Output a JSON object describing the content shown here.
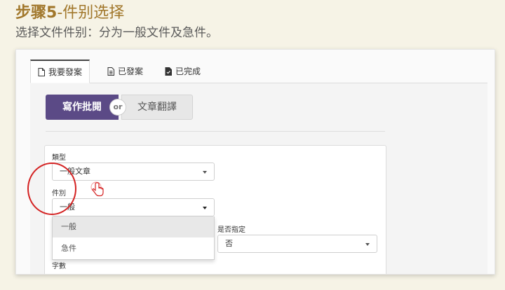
{
  "step": {
    "title_bold": "步骤5",
    "title_rest": "-件别选择",
    "subtitle": "选择文件件别：分为一般文件及急件。"
  },
  "tabs": [
    {
      "label": "我要發案",
      "icon": "document-icon"
    },
    {
      "label": "已發案",
      "icon": "file-lines-icon"
    },
    {
      "label": "已完成",
      "icon": "file-check-icon"
    }
  ],
  "service_toggle": {
    "option_a": "寫作批閱",
    "separator": "or",
    "option_b": "文章翻譯"
  },
  "form": {
    "type_label": "類型",
    "type_value": "一般文章",
    "category_label": "件別",
    "category_value": "一般",
    "category_options": [
      "一般",
      "急件"
    ],
    "designated_label": "是否指定",
    "designated_value": "否",
    "word_count_label": "字數"
  },
  "colors": {
    "step_title": "#a1772b",
    "primary_button": "#5b4a86",
    "highlight_circle": "#d42222"
  }
}
